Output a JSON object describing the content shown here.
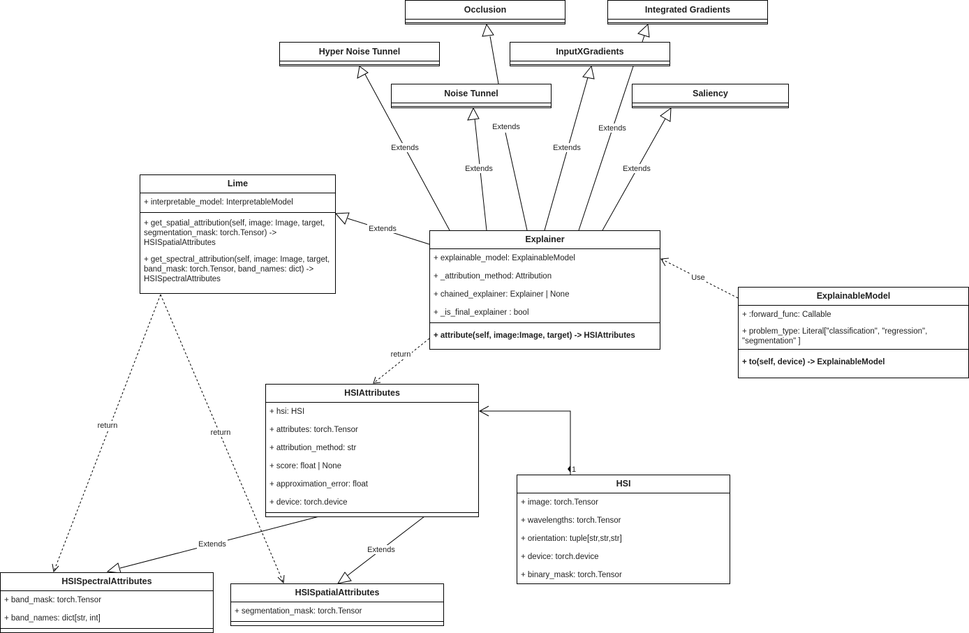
{
  "diagram": {
    "type": "UML class diagram",
    "classes": {
      "occlusion": {
        "name": "Occlusion",
        "attributes": [],
        "operations": []
      },
      "integrated_gradients": {
        "name": "Integrated Gradients",
        "attributes": [],
        "operations": []
      },
      "hyper_noise_tunnel": {
        "name": "Hyper Noise Tunnel",
        "attributes": [],
        "operations": []
      },
      "input_x_gradients": {
        "name": "InputXGradients",
        "attributes": [],
        "operations": []
      },
      "noise_tunnel": {
        "name": "Noise Tunnel",
        "attributes": [],
        "operations": []
      },
      "saliency": {
        "name": "Saliency",
        "attributes": [],
        "operations": []
      },
      "lime": {
        "name": "Lime",
        "attributes": [
          "+ interpretable_model:  InterpretableModel"
        ],
        "operations": [
          "+ get_spatial_attribution(self, image: Image, target, segmentation_mask: torch.Tensor) -> HSISpatialAttributes",
          "+ get_spectral_attribution(self, image: Image, target, band_mask: torch.Tensor, band_names: dict) -> HSISpectralAttributes"
        ]
      },
      "explainer": {
        "name": "Explainer",
        "attributes": [
          "+ explainable_model: ExplainableModel",
          "+ _attribution_method: Attribution",
          "+ chained_explainer: Explainer | None",
          "+ _is_final_explainer : bool"
        ],
        "operations": [
          "+ attribute(self, image:Image, target) -> HSIAttributes"
        ]
      },
      "explainable_model": {
        "name": "ExplainableModel",
        "attributes": [
          "+ :forward_func: Callable",
          "+ problem_type: Literal[\"classification\", \"regression\", \"segmentation\" ]"
        ],
        "operations": [
          "+ to(self, device) -> ExplainableModel"
        ]
      },
      "hsi_attributes": {
        "name": "HSIAttributes",
        "attributes": [
          "+ hsi: HSI",
          "+ attributes: torch.Tensor",
          "+ attribution_method: str",
          "+ score: float | None",
          "+ approximation_error: float",
          "+ device: torch.device"
        ],
        "operations": []
      },
      "hsi": {
        "name": "HSI",
        "attributes": [
          "+ image: torch.Tensor",
          "+ wavelengths: torch.Tensor",
          "+ orientation: tuple[str,str,str]",
          "+ device: torch.device",
          "+ binary_mask: torch.Tensor"
        ],
        "operations": []
      },
      "hsi_spectral_attributes": {
        "name": "HSISpectralAttributes",
        "attributes": [
          "+ band_mask: torch.Tensor",
          "+ band_names: dict[str, int]"
        ],
        "operations": []
      },
      "hsi_spatial_attributes": {
        "name": "HSISpatialAttributes",
        "attributes": [
          "+ segmentation_mask: torch.Tensor"
        ],
        "operations": []
      }
    },
    "relationships": [
      {
        "from": "Explainer",
        "to": "Hyper Noise Tunnel",
        "kind": "generalization",
        "label": "Extends"
      },
      {
        "from": "Explainer",
        "to": "Noise Tunnel",
        "kind": "generalization",
        "label": "Extends"
      },
      {
        "from": "Explainer",
        "to": "Occlusion",
        "kind": "generalization",
        "label": "Extends"
      },
      {
        "from": "Explainer",
        "to": "InputXGradients",
        "kind": "generalization",
        "label": "Extends"
      },
      {
        "from": "Explainer",
        "to": "Integrated Gradients",
        "kind": "generalization",
        "label": "Extends"
      },
      {
        "from": "Explainer",
        "to": "Saliency",
        "kind": "generalization",
        "label": "Extends"
      },
      {
        "from": "Explainer",
        "to": "Lime",
        "kind": "generalization",
        "label": "Extends"
      },
      {
        "from": "ExplainableModel",
        "to": "Explainer",
        "kind": "dependency",
        "label": "Use"
      },
      {
        "from": "Explainer",
        "to": "HSIAttributes",
        "kind": "dependency",
        "label": "return"
      },
      {
        "from": "Lime",
        "to": "HSISpectralAttributes",
        "kind": "dependency",
        "label": "return"
      },
      {
        "from": "Lime",
        "to": "HSISpatialAttributes",
        "kind": "dependency",
        "label": "return"
      },
      {
        "from": "HSIAttributes",
        "to": "HSISpectralAttributes",
        "kind": "generalization",
        "label": "Extends"
      },
      {
        "from": "HSIAttributes",
        "to": "HSISpatialAttributes",
        "kind": "generalization",
        "label": "Extends"
      },
      {
        "from": "HSI",
        "to": "HSIAttributes",
        "kind": "association",
        "label": "",
        "multiplicity": "1"
      }
    ],
    "labels": {
      "extends": "Extends",
      "use": "Use",
      "return": "return",
      "multiplicity_one": "1"
    }
  }
}
